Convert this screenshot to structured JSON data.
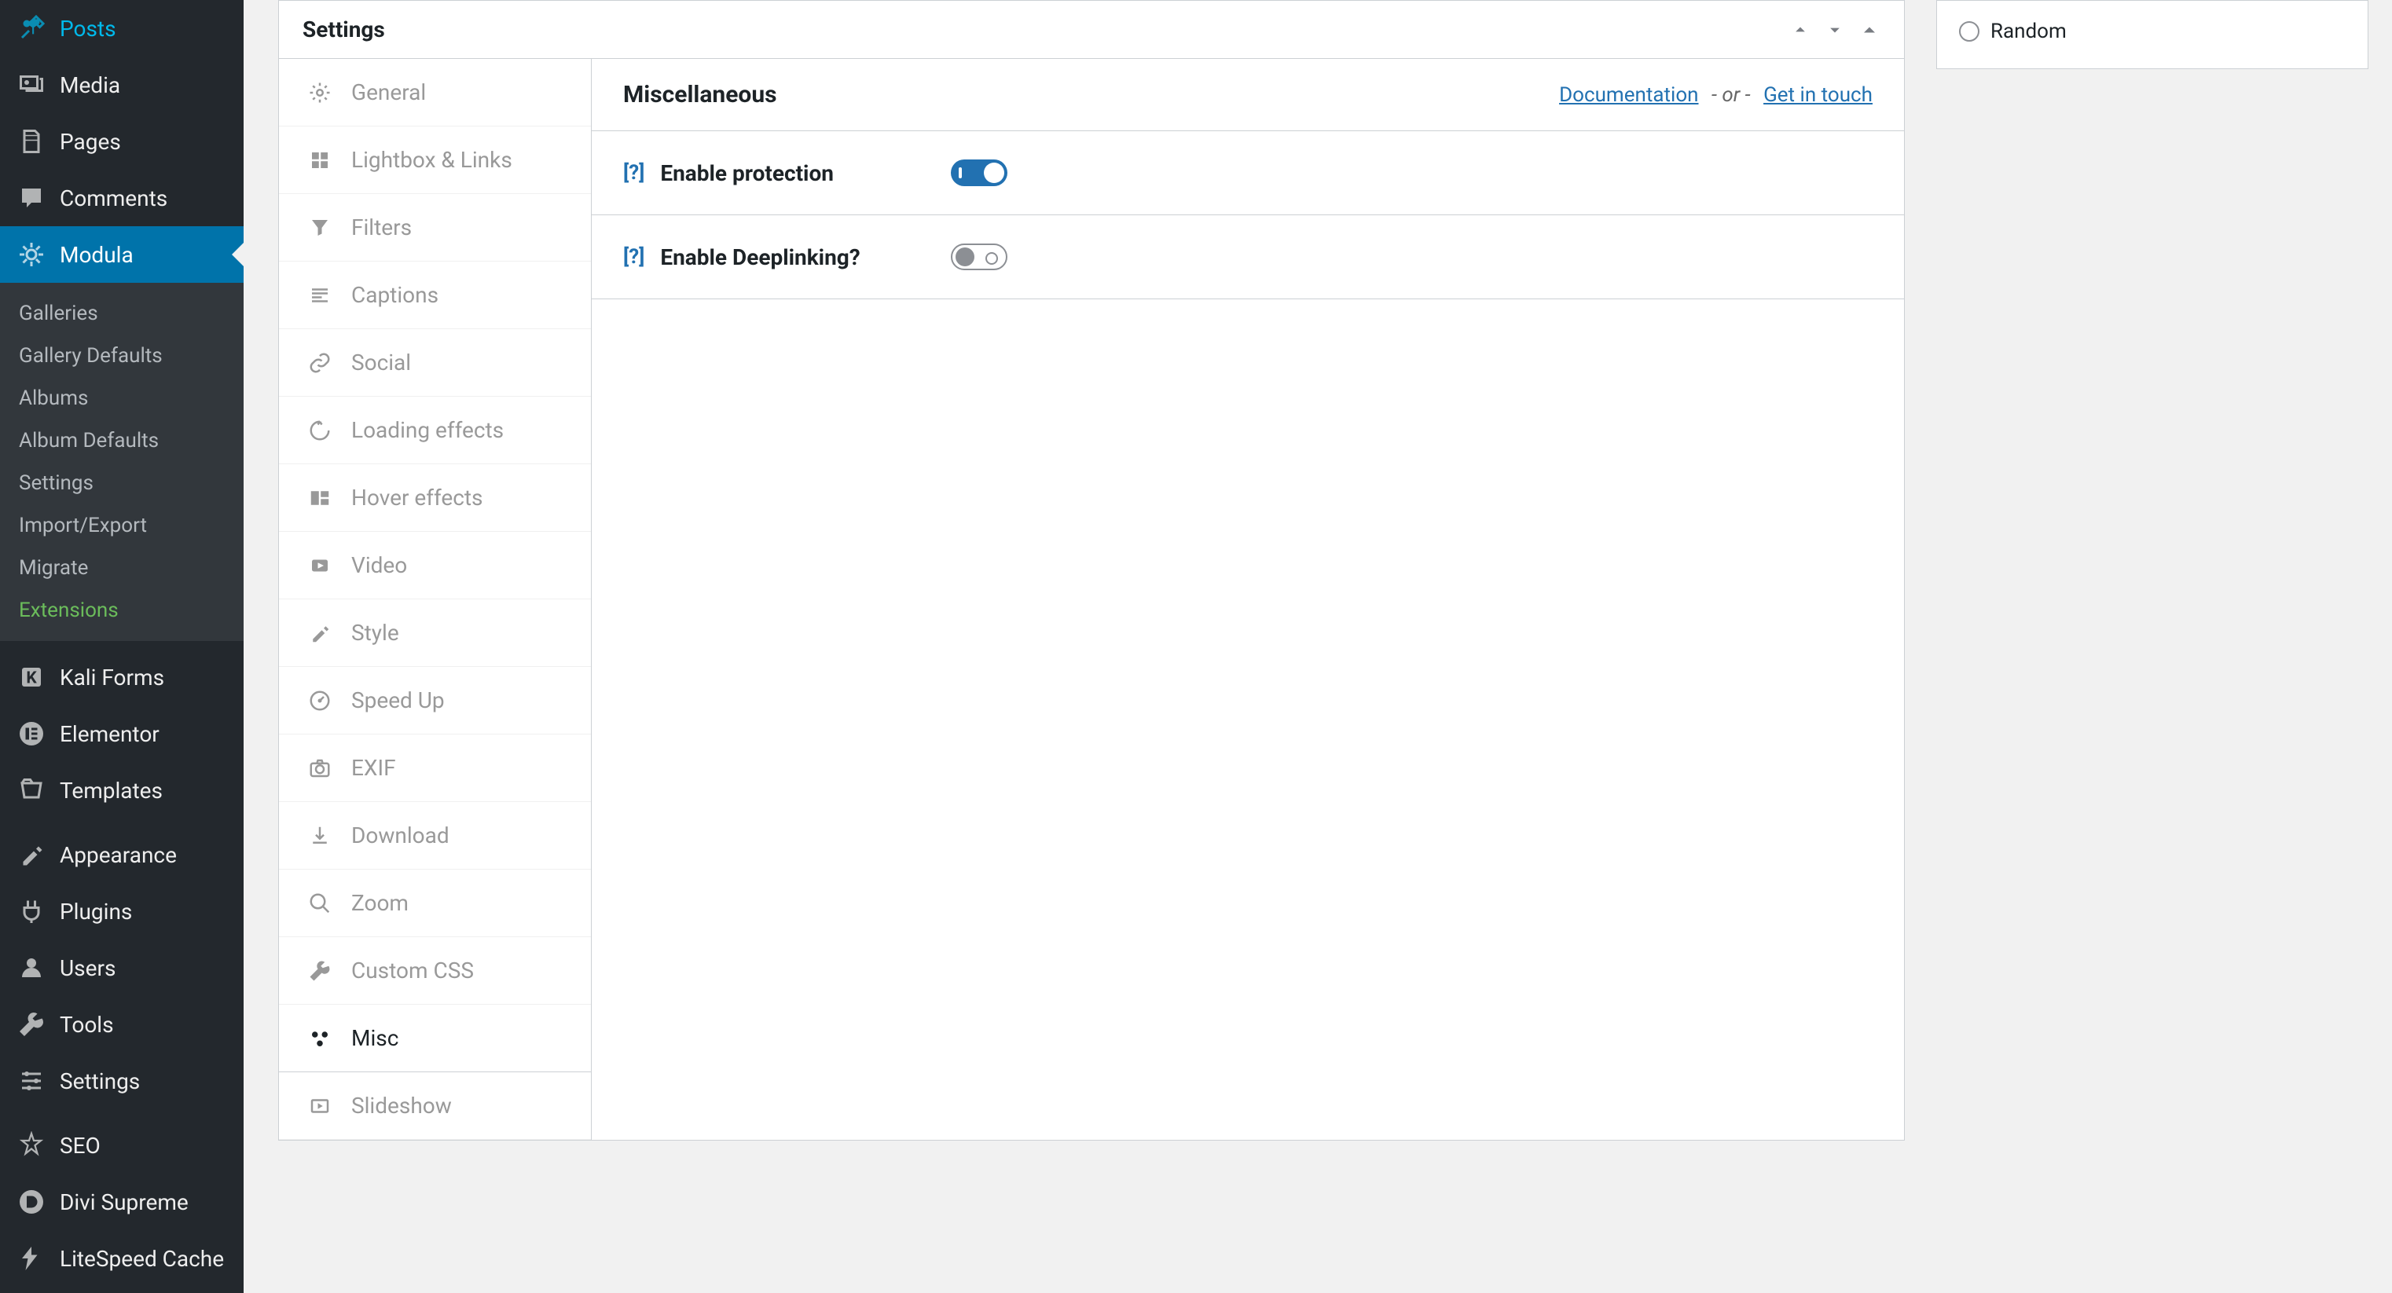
{
  "wp_menu": [
    {
      "icon": "pin",
      "label": "Posts"
    },
    {
      "icon": "media",
      "label": "Media"
    },
    {
      "icon": "page",
      "label": "Pages"
    },
    {
      "icon": "comment",
      "label": "Comments"
    },
    {
      "icon": "modula",
      "label": "Modula",
      "active": true
    },
    {
      "icon": "k",
      "label": "Kali Forms"
    },
    {
      "icon": "elementor",
      "label": "Elementor"
    },
    {
      "icon": "templates",
      "label": "Templates"
    },
    {
      "icon": "appearance",
      "label": "Appearance"
    },
    {
      "icon": "plugins",
      "label": "Plugins"
    },
    {
      "icon": "users",
      "label": "Users"
    },
    {
      "icon": "tools",
      "label": "Tools"
    },
    {
      "icon": "settings",
      "label": "Settings"
    },
    {
      "icon": "seo",
      "label": "SEO"
    },
    {
      "icon": "divi",
      "label": "Divi Supreme"
    },
    {
      "icon": "litespeed",
      "label": "LiteSpeed Cache"
    }
  ],
  "wp_submenu": [
    {
      "label": "Galleries"
    },
    {
      "label": "Gallery Defaults"
    },
    {
      "label": "Albums"
    },
    {
      "label": "Album Defaults"
    },
    {
      "label": "Settings"
    },
    {
      "label": "Import/Export"
    },
    {
      "label": "Migrate"
    },
    {
      "label": "Extensions",
      "cls": "ext"
    }
  ],
  "panel": {
    "title": "Settings",
    "tabs": [
      {
        "icon": "gear",
        "label": "General"
      },
      {
        "icon": "lightbox",
        "label": "Lightbox & Links"
      },
      {
        "icon": "filter",
        "label": "Filters"
      },
      {
        "icon": "captions",
        "label": "Captions"
      },
      {
        "icon": "link",
        "label": "Social"
      },
      {
        "icon": "loading",
        "label": "Loading effects"
      },
      {
        "icon": "hover",
        "label": "Hover effects"
      },
      {
        "icon": "video",
        "label": "Video"
      },
      {
        "icon": "style",
        "label": "Style"
      },
      {
        "icon": "speed",
        "label": "Speed Up"
      },
      {
        "icon": "camera",
        "label": "EXIF"
      },
      {
        "icon": "download",
        "label": "Download"
      },
      {
        "icon": "zoom",
        "label": "Zoom"
      },
      {
        "icon": "wrench",
        "label": "Custom CSS"
      },
      {
        "icon": "misc",
        "label": "Misc",
        "active": true
      },
      {
        "icon": "slideshow",
        "label": "Slideshow"
      }
    ],
    "content": {
      "title": "Miscellaneous",
      "doc_label": "Documentation",
      "or_text": "-  or  -",
      "contact_label": "Get in touch",
      "options": [
        {
          "help": "[?]",
          "label": "Enable protection",
          "state": "on"
        },
        {
          "help": "[?]",
          "label": "Enable Deeplinking?",
          "state": "off"
        }
      ]
    }
  },
  "right_box": {
    "options": [
      {
        "label": "Random"
      }
    ]
  }
}
